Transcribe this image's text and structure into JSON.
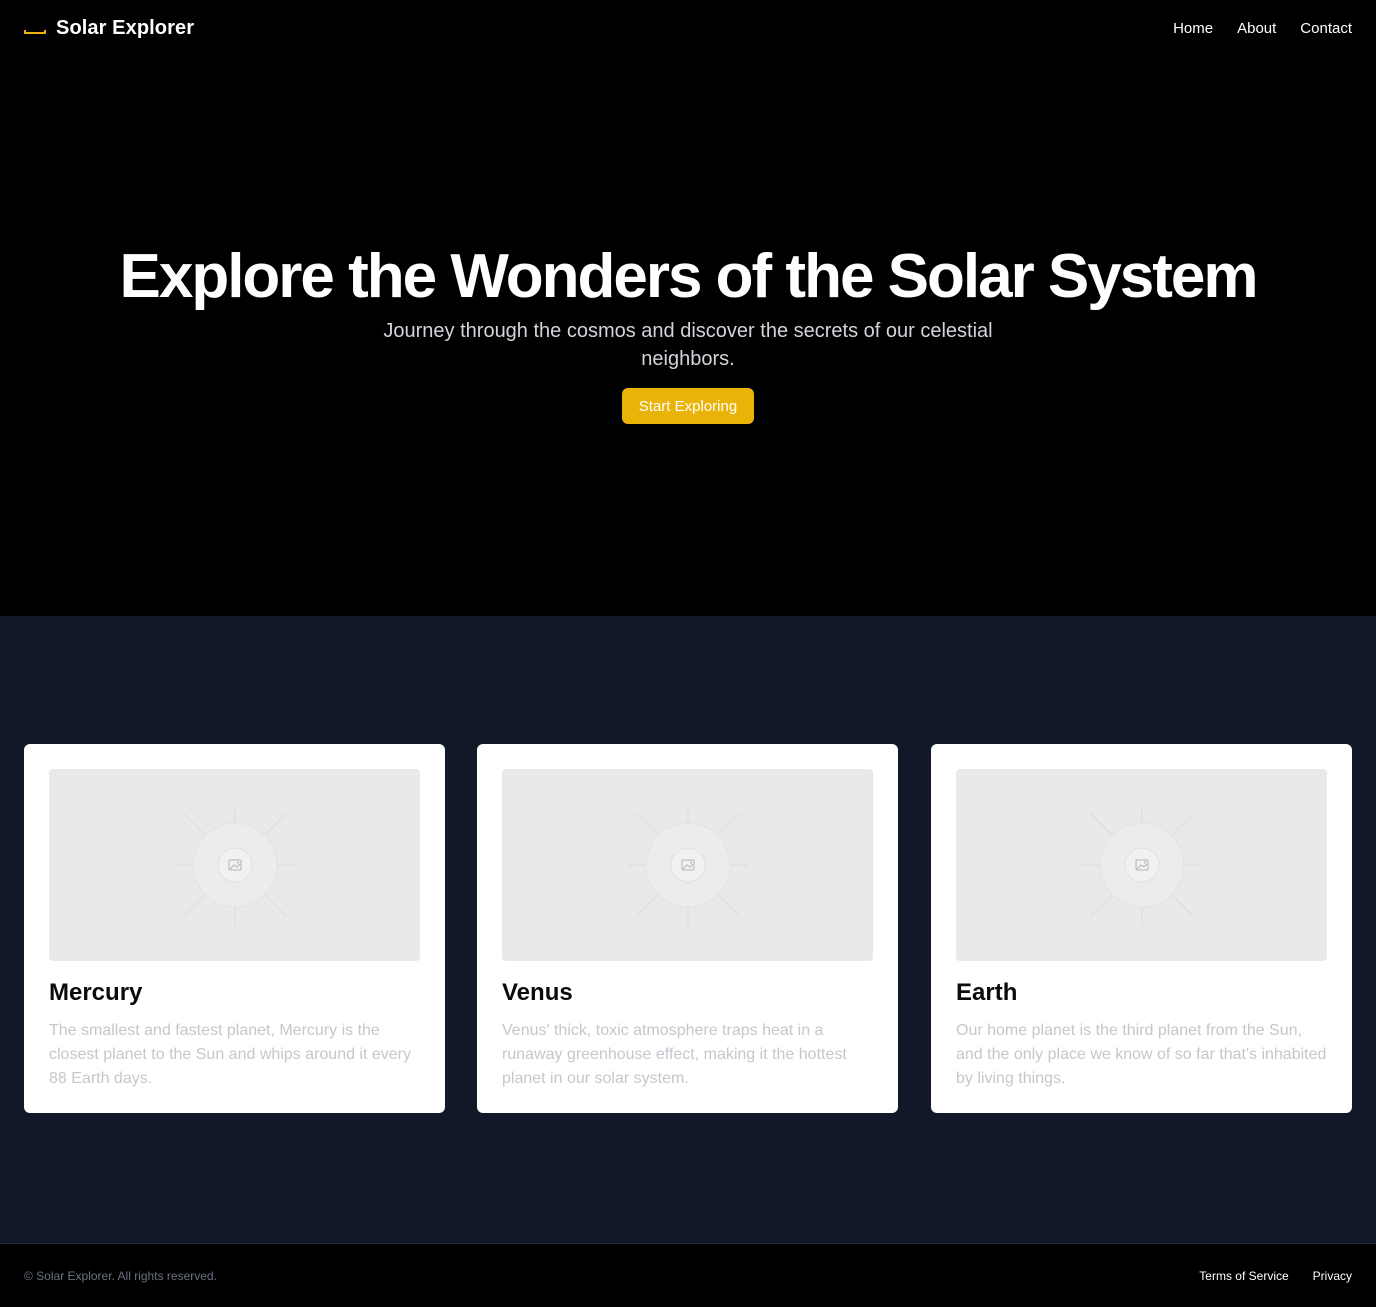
{
  "header": {
    "brand_name": "Solar Explorer",
    "brand_icon": "sun-bracket-icon",
    "nav": [
      {
        "label": "Home"
      },
      {
        "label": "About"
      },
      {
        "label": "Contact"
      }
    ]
  },
  "hero": {
    "title": "Explore the Wonders of the Solar System",
    "subtitle": "Journey through the cosmos and discover the secrets of our celestial neighbors.",
    "cta_label": "Start Exploring"
  },
  "cards": [
    {
      "image_icon": "image-placeholder-icon",
      "title": "Mercury",
      "description": "The smallest and fastest planet, Mercury is the closest planet to the Sun and whips around it every 88 Earth days."
    },
    {
      "image_icon": "image-placeholder-icon",
      "title": "Venus",
      "description": "Venus' thick, toxic atmosphere traps heat in a runaway greenhouse effect, making it the hottest planet in our solar system."
    },
    {
      "image_icon": "image-placeholder-icon",
      "title": "Earth",
      "description": "Our home planet is the third planet from the Sun, and the only place we know of so far that's inhabited by living things."
    }
  ],
  "footer": {
    "copyright": "© Solar Explorer. All rights reserved.",
    "links": [
      {
        "label": "Terms of Service"
      },
      {
        "label": "Privacy"
      }
    ]
  },
  "colors": {
    "accent": "#eab308",
    "hero_background": "#000000",
    "section_background": "#111827",
    "card_background": "#ffffff"
  }
}
